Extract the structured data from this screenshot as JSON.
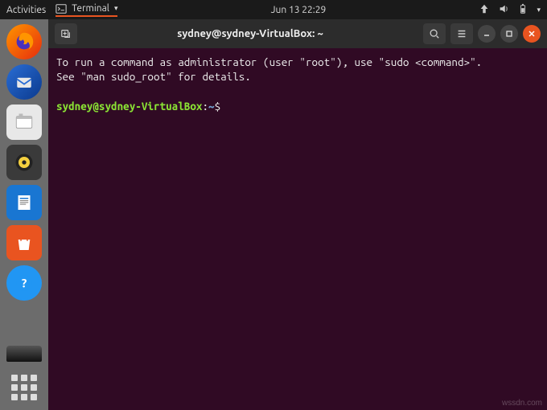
{
  "topbar": {
    "activities": "Activities",
    "app_name": "Terminal",
    "datetime": "Jun 13  22:29"
  },
  "dock": {
    "items": [
      {
        "name": "firefox"
      },
      {
        "name": "thunderbird"
      },
      {
        "name": "files"
      },
      {
        "name": "rhythmbox"
      },
      {
        "name": "libreoffice-writer"
      },
      {
        "name": "ubuntu-software"
      },
      {
        "name": "help"
      }
    ]
  },
  "window": {
    "title": "sydney@sydney-VirtualBox: ~"
  },
  "terminal": {
    "motd_line1": "To run a command as administrator (user \"root\"), use \"sudo <command>\".",
    "motd_line2": "See \"man sudo_root\" for details.",
    "prompt_user": "sydney@sydney-VirtualBox",
    "prompt_colon": ":",
    "prompt_path": "~",
    "prompt_symbol": "$ "
  },
  "watermark": "wssdn.com"
}
